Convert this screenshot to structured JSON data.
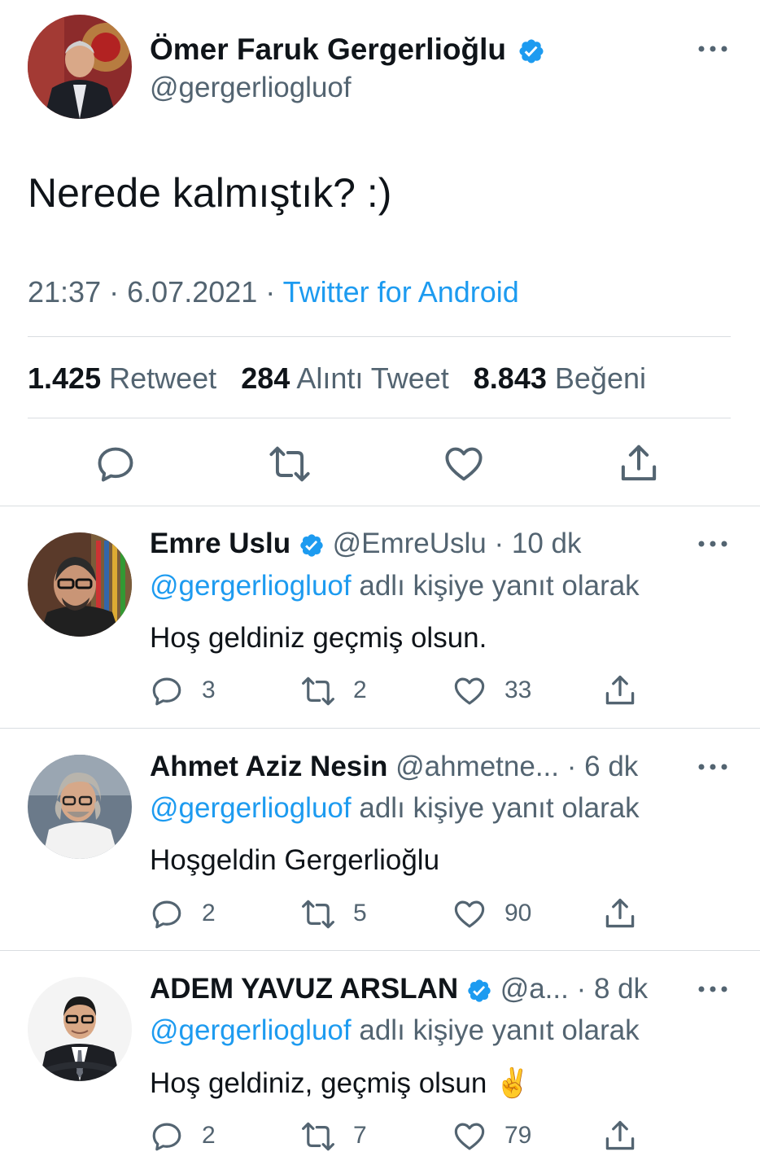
{
  "main_tweet": {
    "author_name": "Ömer Faruk Gergerlioğlu",
    "author_handle": "@gergerliogluof",
    "verified": true,
    "text": "Nerede kalmıştık? :)",
    "time": "21:37",
    "date": "6.07.2021",
    "source": "Twitter for Android",
    "separator": "·",
    "stats": {
      "retweets_count": "1.425",
      "retweets_label": "Retweet",
      "quotes_count": "284",
      "quotes_label": "Alıntı Tweet",
      "likes_count": "8.843",
      "likes_label": "Beğeni"
    },
    "actions": [
      "reply-icon",
      "retweet-icon",
      "like-icon",
      "share-icon"
    ]
  },
  "replies": [
    {
      "author_name": "Emre Uslu",
      "verified": true,
      "author_handle": "@EmreUslu",
      "time_ago": "· 10 dk",
      "reply_to_handle": "@gergerliogluof",
      "reply_to_suffix": "adlı kişiye yanıt olarak",
      "text": "Hoş geldiniz geçmiş olsun.",
      "reply_count": "3",
      "retweet_count": "2",
      "like_count": "33"
    },
    {
      "author_name": "Ahmet Aziz Nesin",
      "verified": false,
      "author_handle": "@ahmetne...",
      "time_ago": "· 6 dk",
      "reply_to_handle": "@gergerliogluof",
      "reply_to_suffix": "adlı kişiye yanıt olarak",
      "text": "Hoşgeldin Gergerlioğlu",
      "reply_count": "2",
      "retweet_count": "5",
      "like_count": "90"
    },
    {
      "author_name": "ADEM YAVUZ ARSLAN",
      "verified": true,
      "author_handle": "@a...",
      "time_ago": "· 8 dk",
      "reply_to_handle": "@gergerliogluof",
      "reply_to_suffix": "adlı kişiye yanıt olarak",
      "text": "Hoş geldiniz, geçmiş olsun ✌️",
      "reply_count": "2",
      "retweet_count": "7",
      "like_count": "79"
    }
  ],
  "colors": {
    "accent": "#1d9bf0",
    "text_primary": "#0f1419",
    "text_secondary": "#536471",
    "divider": "#d9dde1"
  }
}
